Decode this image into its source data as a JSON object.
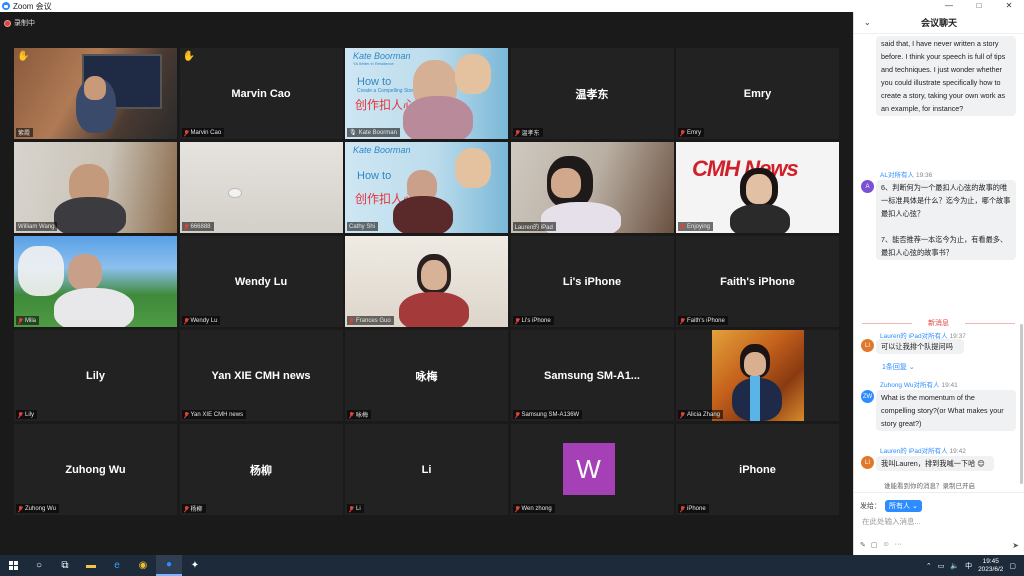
{
  "window": {
    "title": "Zoom 会议",
    "minimize": "—",
    "maximize": "□",
    "close": "✕"
  },
  "recording": {
    "label": "录制中"
  },
  "tiles": [
    {
      "name": "紫霞",
      "hand": true,
      "muted": false,
      "video": "photo-man-drinking"
    },
    {
      "name": "Marvin Cao",
      "display": "Marvin Cao",
      "hand": true,
      "muted": true
    },
    {
      "name": "Kate Boorman",
      "muted": false,
      "video": "slide-speaker",
      "active": true
    },
    {
      "name": "温孝东",
      "display": "温孝东",
      "muted": true
    },
    {
      "name": "Emry",
      "display": "Emry",
      "muted": true
    },
    {
      "name": "William Wang",
      "muted": false,
      "video": "photo-man-hands"
    },
    {
      "name": "666888",
      "muted": true,
      "video": "photo-wall"
    },
    {
      "name": "Cathy Shi",
      "muted": false,
      "video": "slide-woman"
    },
    {
      "name": "Lauren的 iPad",
      "muted": false,
      "video": "photo-woman-room"
    },
    {
      "name": "Enjoying",
      "muted": true,
      "video": "photo-cmh-news"
    },
    {
      "name": "Mila",
      "muted": true,
      "video": "photo-outdoor-man"
    },
    {
      "name": "Wendy Lu",
      "display": "Wendy Lu",
      "muted": true
    },
    {
      "name": "Frances Guo",
      "muted": true,
      "video": "photo-woman-office"
    },
    {
      "name": "Li's iPhone",
      "display": "Li's iPhone",
      "muted": true
    },
    {
      "name": "Faith's iPhone",
      "display": "Faith's iPhone",
      "muted": true
    },
    {
      "name": "Lily",
      "display": "Lily",
      "muted": true
    },
    {
      "name": "Yan XIE CMH news",
      "display": "Yan XIE CMH news",
      "muted": true
    },
    {
      "name": "咏梅",
      "display": "咏梅",
      "muted": true
    },
    {
      "name": "Samsung SM-A136W",
      "display": "Samsung  SM-A1...",
      "muted": true
    },
    {
      "name": "Alicia Zhang",
      "muted": true,
      "video": "photo-autumn-woman"
    },
    {
      "name": "Zuhong Wu",
      "display": "Zuhong Wu",
      "muted": true
    },
    {
      "name": "杨柳",
      "display": "杨柳",
      "muted": true
    },
    {
      "name": "Li",
      "display": "Li",
      "muted": true
    },
    {
      "name": "Wen zhong",
      "muted": true,
      "letter": "W"
    },
    {
      "name": "iPhone",
      "display": "iPhone",
      "muted": true
    }
  ],
  "slide": {
    "title": "Kate Boorman",
    "subtitle": "YA Writer in Residence",
    "how": "How to",
    "small": "Create a Compelling Story",
    "zh": "创作扣人心弦"
  },
  "cmh_logo": "CMH News",
  "chat": {
    "header": "会议聊天",
    "messages": [
      {
        "text": "said that, I have never written a story before. I think your speech is full of tips and techniques. I just wonder whether you could illustrate specifically how to create a story, taking your own work as an example, for instance?"
      },
      {
        "sender": "AL",
        "to": "对所有人",
        "time": "19:36",
        "avatar": "A",
        "avatar_color": "#7b4fd6",
        "text": "6、判断何为一个最扣人心弦的故事的唯一标准具体是什么？迄今为止，哪个故事最扣人心弦？\n\n7、能否推荐一本迄今为止，有看最多、最扣人心弦的故事书？"
      },
      {
        "sender": "Lauren的 iPad",
        "to": "对所有人",
        "time": "19:37",
        "avatar": "LI",
        "avatar_color": "#e0782c",
        "text": "可以让我排个队提问吗"
      },
      {
        "sender": "Zuhong Wu",
        "to": "对所有人",
        "time": "19:41",
        "avatar": "ZW",
        "avatar_color": "#2d8cff",
        "text": "What is the momentum of the compelling story?(or What makes your story great?)"
      },
      {
        "sender": "Lauren的 iPad",
        "to": "对所有人",
        "time": "19:42",
        "avatar": "LI",
        "avatar_color": "#e0782c",
        "text": "我叫Lauren，排到我喊一下哈 😊"
      }
    ],
    "new_messages": "新消息",
    "reply_count": "1条回复 ⌄",
    "privacy": "谁能看到你的消息？录制已开启",
    "send_to_label": "发给：",
    "send_to_value": "所有人 ⌄",
    "placeholder": "在此处输入消息..."
  },
  "taskbar": {
    "time": "19:45",
    "date": "2023/6/2",
    "ime": "中"
  }
}
